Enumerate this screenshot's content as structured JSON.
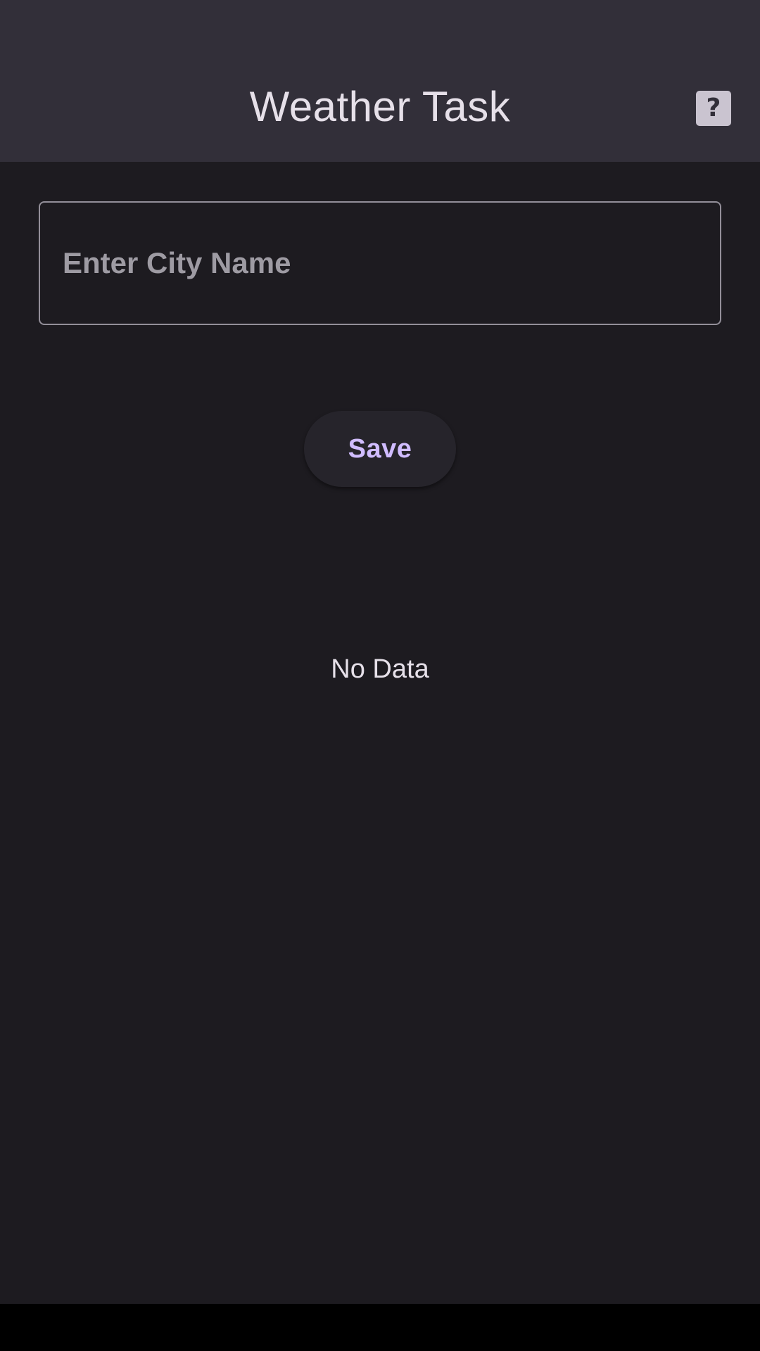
{
  "app_bar": {
    "title": "Weather Task",
    "help_icon": "help-question-icon",
    "help_glyph": "?"
  },
  "city_input": {
    "placeholder": "Enter City Name",
    "value": ""
  },
  "actions": {
    "save_label": "Save"
  },
  "content": {
    "empty_message": "No Data"
  },
  "colors": {
    "background": "#1d1b20",
    "app_bar": "#322f39",
    "accent": "#d0bcff",
    "text": "#e6e0e9"
  }
}
